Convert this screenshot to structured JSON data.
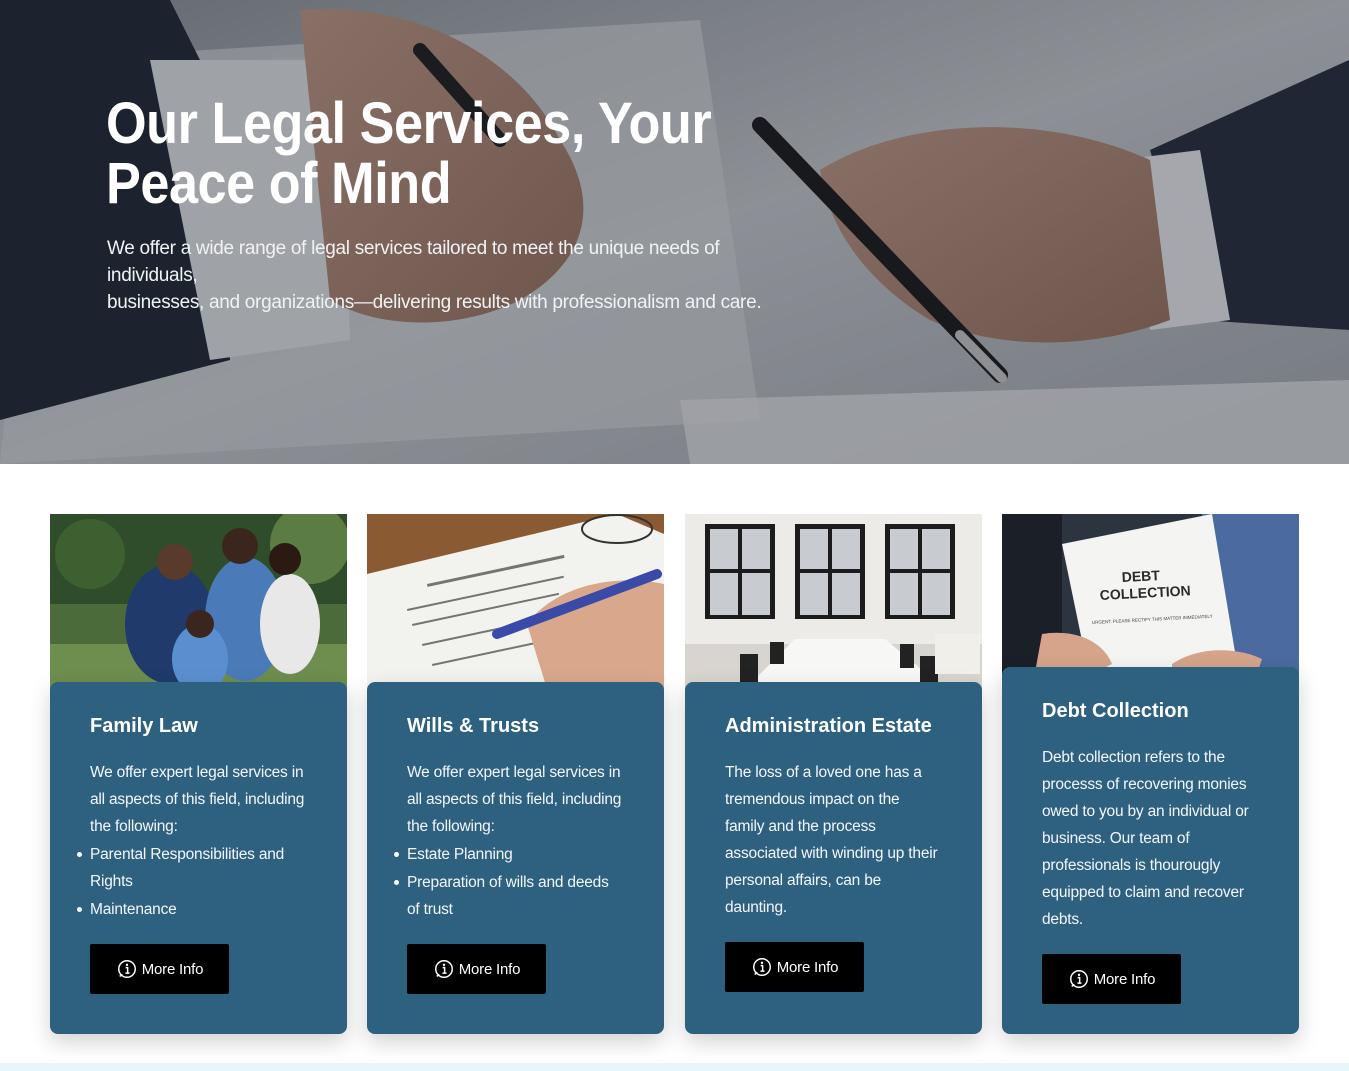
{
  "hero": {
    "title_line1": "Our Legal Services, Your",
    "title_line2": "Peace of Mind",
    "subtitle_line1": "We offer a wide range of legal services tailored to meet the unique needs of individuals,",
    "subtitle_line2": "businesses, and organizations—delivering results with professionalism and care."
  },
  "cards": [
    {
      "title": "Family Law",
      "description": "We offer expert legal services in all aspects of this field, including the following:",
      "items": [
        "Parental Responsibilities and Rights",
        "Maintenance"
      ],
      "button_label": "More Info",
      "image": "family-photo"
    },
    {
      "title": "Wills & Trusts",
      "description": "We offer expert legal services in all aspects of this field, including the following:",
      "items": [
        "Estate Planning",
        "Preparation of wills and deeds of trust"
      ],
      "button_label": "More Info",
      "image": "will-signing-photo"
    },
    {
      "title": "Administration Estate",
      "description": "The loss of a loved one has a tremendous impact on the family and the process associated with winding up their personal affairs, can be daunting.",
      "items": [],
      "button_label": "More Info",
      "image": "boardroom-photo"
    },
    {
      "title": "Debt Collection",
      "description": "Debt collection refers to the processs of recovering monies owed to you by an individual or business. Our team of professionals is thourougly equipped to claim and recover debts.",
      "items": [],
      "button_label": "More Info",
      "image": "debt-letter-photo",
      "image_text_line1": "DEBT",
      "image_text_line2": "COLLECTION",
      "image_doc_label": "URGENT: PLEASE RECTIFY THIS MATTER IMMEDIATELY"
    }
  ],
  "colors": {
    "card_panel": "#2e617f",
    "button": "#000000",
    "bottom_strip": "#e8f6fb"
  },
  "icons": {
    "button_icon": "info-icon"
  }
}
